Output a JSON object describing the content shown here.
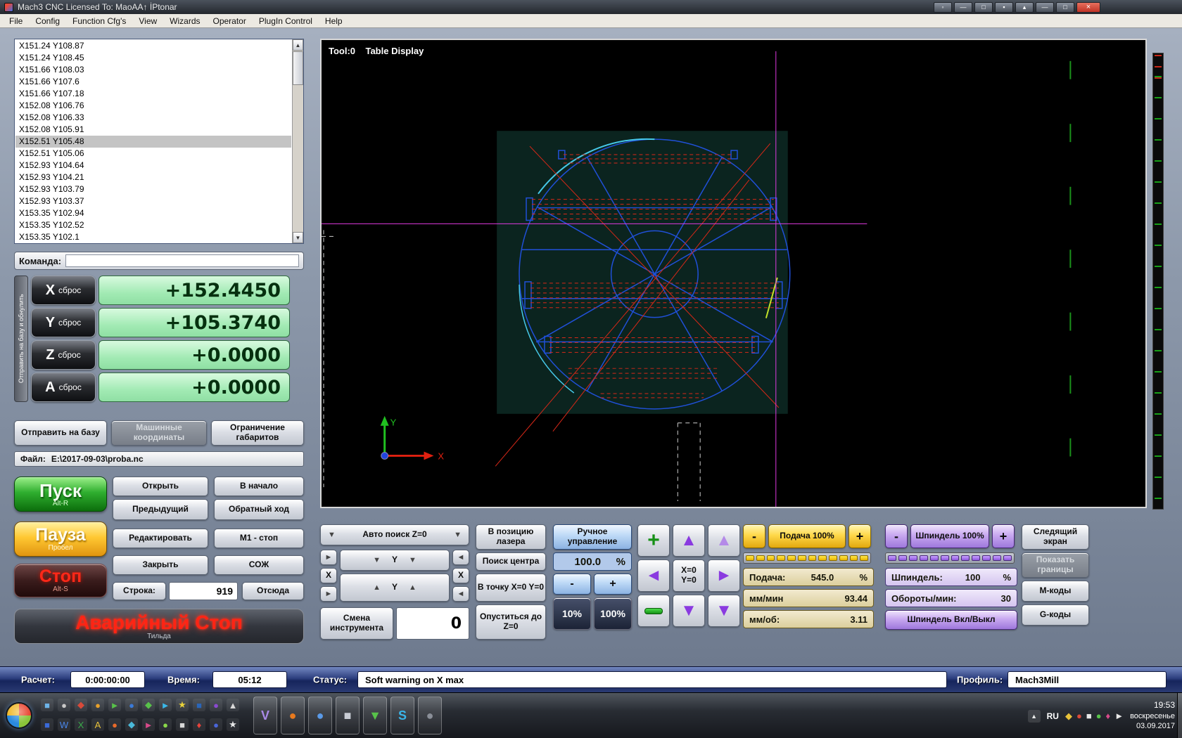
{
  "window": {
    "title": "Mach3 CNC  Licensed To: MaoAA↑ İPtonar",
    "menu": [
      "File",
      "Config",
      "Function Cfg's",
      "View",
      "Wizards",
      "Operator",
      "PlugIn Control",
      "Help"
    ],
    "buttons": [
      {
        "name": "pin-button",
        "glyph": "◦"
      },
      {
        "name": "minimize-button",
        "glyph": "—"
      },
      {
        "name": "restore-button",
        "glyph": "□"
      },
      {
        "name": "overlay-panel-button",
        "glyph": "▪"
      },
      {
        "name": "overlay-up-button",
        "glyph": "▴"
      },
      {
        "name": "minimize-2-button",
        "glyph": "—"
      },
      {
        "name": "restore-2-button",
        "glyph": "□"
      },
      {
        "name": "close-button",
        "glyph": "×"
      }
    ]
  },
  "gcode": {
    "selected_index": 8,
    "lines": [
      "X151.24 Y108.87",
      "X151.24 Y108.45",
      "X151.66 Y108.03",
      "X151.66 Y107.6",
      "X151.66 Y107.18",
      "X152.08 Y106.76",
      "X152.08 Y106.33",
      "X152.08 Y105.91",
      "X152.51 Y105.48",
      "X152.51 Y105.06",
      "X152.93 Y104.64",
      "X152.93 Y104.21",
      "X152.93 Y103.79",
      "X152.93 Y103.37",
      "X153.35 Y102.94",
      "X153.35 Y102.52",
      "X153.35 Y102.1"
    ]
  },
  "command": {
    "label": "Команда:"
  },
  "dro": {
    "home_chip": "Отправить на базу и обнулить",
    "axes": [
      {
        "axis": "X",
        "reset": "сброс",
        "value": "+152.4450"
      },
      {
        "axis": "Y",
        "reset": "сброс",
        "value": "+105.3740"
      },
      {
        "axis": "Z",
        "reset": "сброс",
        "value": "+0.0000"
      },
      {
        "axis": "A",
        "reset": "сброс",
        "value": "+0.0000"
      }
    ],
    "home_button": "Отправить на базу",
    "machine_coords_button": "Машинные координаты",
    "limits_button": "Ограничение габаритов"
  },
  "file_bar": {
    "label": "Файл:",
    "path": "E:\\2017-09-03\\proba.nc"
  },
  "run": {
    "start": "Пуск",
    "start_sub": "Alt-R",
    "pause": "Пауза",
    "pause_sub": "Пробел",
    "stop": "Стоп",
    "stop_sub": "Alt-S",
    "estop": "Аварийный Стоп",
    "estop_sub": "Тильда",
    "open": "Открыть",
    "to_start": "В начало",
    "previous": "Предыдущий",
    "reverse": "Обратный ход",
    "edit": "Редактировать",
    "m1_stop": "М1 - стоп",
    "close": "Закрыть",
    "coolant": "СОЖ",
    "line_label": "Строка:",
    "line_value": "919",
    "from_here": "Отсюда"
  },
  "display": {
    "header": "Tool:0    Table Display",
    "axis_x": "X",
    "axis_y": "Y"
  },
  "jog": {
    "auto_z": "Авто поиск Z=0",
    "arrow_up": "▲",
    "arrow_down": "▼",
    "arrow_left": "◄",
    "arrow_right": "►",
    "x": "X",
    "y": "Y",
    "tool_change": "Смена инструмента",
    "tool_number": "0",
    "laser": "В позицию лазера",
    "center": "Поиск центра",
    "goto_zero": "В точку X=0 Y=0",
    "down_z": "Опуститься до Z=0",
    "manual": "Ручное управление",
    "percent": "100.0",
    "unit": "%",
    "minus": "-",
    "plus": "+",
    "p10": "10%",
    "p100": "100%"
  },
  "pad": {
    "plus": "+",
    "xy_zero": "X=0 Y=0",
    "up": "▲",
    "down": "▼",
    "left": "◄",
    "right": "►"
  },
  "feed": {
    "minus": "-",
    "label": "Подача 100%",
    "plus": "+",
    "feed_label": "Подача:",
    "feed_value": "545.0",
    "feed_unit": "%",
    "mmmin_label": "мм/мин",
    "mmmin_value": "93.44",
    "mmrev_label": "мм/об:",
    "mmrev_value": "3.11"
  },
  "spindle": {
    "minus": "-",
    "label": "Шпиндель 100%",
    "plus": "+",
    "sp_label": "Шпиндель:",
    "sp_value": "100",
    "sp_unit": "%",
    "rpm_label": "Обороты/мин:",
    "rpm_value": "30",
    "toggle": "Шпиндель Вкл/Выкл"
  },
  "right_panel": {
    "tracking": "Следящий экран",
    "show_limits": "Показать границы",
    "mcodes": "М-коды",
    "gcodes": "G-коды"
  },
  "status": {
    "calc_label": "Расчет:",
    "calc_value": "0:00:00:00",
    "time_label": "Время:",
    "time_value": "05:12",
    "status_label": "Статус:",
    "status_value": "Soft warning on X max",
    "profile_label": "Профиль:",
    "profile_value": "Mach3Mill"
  },
  "taskbar": {
    "lang": "RU",
    "chevron": "▲",
    "time": "19:53",
    "day": "воскресенье",
    "date": "03.09.2017",
    "quick_row1": [
      {
        "g": "■",
        "c": "#6db3e8"
      },
      {
        "g": "●",
        "c": "#c8c8c8"
      },
      {
        "g": "◆",
        "c": "#d84a3a"
      },
      {
        "g": "●",
        "c": "#e8a02a"
      },
      {
        "g": "►",
        "c": "#58c24a"
      },
      {
        "g": "●",
        "c": "#3a7ad8"
      },
      {
        "g": "◆",
        "c": "#58c24a"
      },
      {
        "g": "►",
        "c": "#3ab8e8"
      },
      {
        "g": "★",
        "c": "#e8d23a"
      },
      {
        "g": "■",
        "c": "#2a66b8"
      },
      {
        "g": "●",
        "c": "#8a4ad0"
      },
      {
        "g": "▲",
        "c": "#d8d8d8"
      }
    ],
    "quick_row2": [
      {
        "g": "■",
        "c": "#3a6ad8"
      },
      {
        "g": "W",
        "c": "#4a86e8"
      },
      {
        "g": "X",
        "c": "#3aa84a"
      },
      {
        "g": "A",
        "c": "#e8c23a"
      },
      {
        "g": "●",
        "c": "#e86a2a"
      },
      {
        "g": "◆",
        "c": "#4ab8d8"
      },
      {
        "g": "►",
        "c": "#d84a8a"
      },
      {
        "g": "●",
        "c": "#8ad84a"
      },
      {
        "g": "■",
        "c": "#d8d8d8"
      },
      {
        "g": "♦",
        "c": "#e8423a"
      },
      {
        "g": "●",
        "c": "#4a66d8"
      },
      {
        "g": "★",
        "c": "#e8e8e8"
      }
    ],
    "apps": [
      {
        "g": "V",
        "c": "#a98ae8"
      },
      {
        "g": "●",
        "c": "#e87a1e"
      },
      {
        "g": "●",
        "c": "#5a9ae8"
      },
      {
        "g": "■",
        "c": "#c8ccd4"
      },
      {
        "g": "▼",
        "c": "#58c24a"
      },
      {
        "g": "S",
        "c": "#3ab4e8"
      },
      {
        "g": "●",
        "c": "#8a8f98"
      }
    ],
    "tray_icons": [
      {
        "g": "◆",
        "c": "#e8c23a"
      },
      {
        "g": "●",
        "c": "#d84a3a"
      },
      {
        "g": "■",
        "c": "#e8e8e8"
      },
      {
        "g": "●",
        "c": "#58c24a"
      },
      {
        "g": "♦",
        "c": "#d84a8a"
      },
      {
        "g": "►",
        "c": "#e8e8e8"
      }
    ]
  }
}
